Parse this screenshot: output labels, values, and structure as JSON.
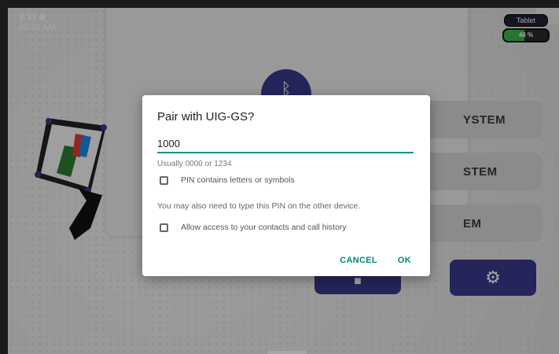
{
  "status": {
    "time": "9:33",
    "clock": "09:33 AM"
  },
  "tablet": {
    "label": "Tablet",
    "battery_text": "46 %",
    "battery_level": 46
  },
  "background": {
    "system_buttons": [
      "YSTEM",
      "STEM",
      "EM"
    ]
  },
  "dialog": {
    "title": "Pair with UIG-GS?",
    "pin_value": "1000",
    "hint": "Usually 0000 or 1234",
    "checkbox_letters": "PIN contains letters or symbols",
    "note": "You may also need to type this PIN on the other device.",
    "checkbox_contacts": "Allow access to your contacts and call history",
    "cancel": "CANCEL",
    "ok": "OK"
  },
  "colors": {
    "accent": "#009688",
    "brand": "#3a3a8c",
    "battery": "#3ab54a"
  }
}
